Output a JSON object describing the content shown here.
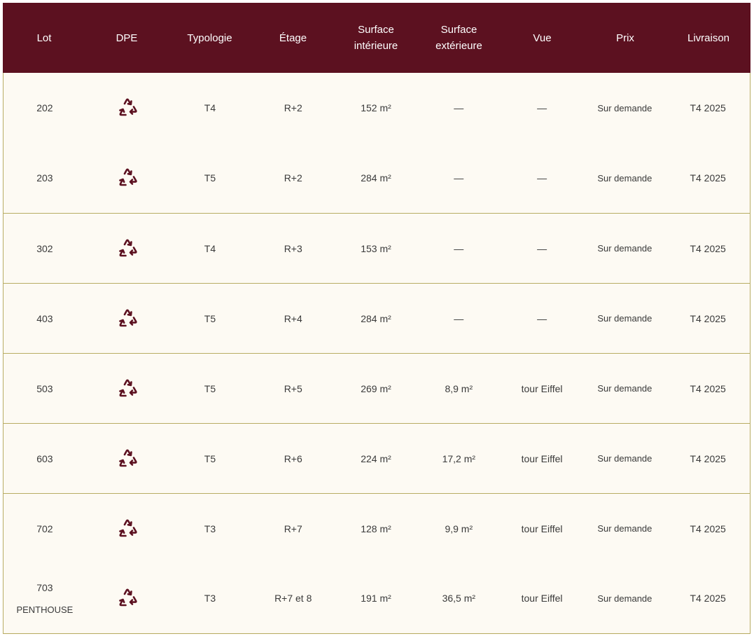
{
  "headers": {
    "lot": "Lot",
    "dpe": "DPE",
    "typologie": "Typologie",
    "etage": "Étage",
    "surface_interieure": "Surface\nintérieure",
    "surface_exterieure": "Surface\nextérieure",
    "vue": "Vue",
    "prix": "Prix",
    "livraison": "Livraison"
  },
  "accent_color": "#5c1120",
  "border_color": "#b8ac63",
  "dpe_icon": "recycle-icon",
  "rows": [
    {
      "lot": "202",
      "lot_sub": "",
      "typologie": "T4",
      "etage": "R+2",
      "surface_int": "152 m²",
      "surface_ext": "—",
      "vue": "—",
      "prix": "Sur demande",
      "livraison": "T4 2025"
    },
    {
      "lot": "203",
      "lot_sub": "",
      "typologie": "T5",
      "etage": "R+2",
      "surface_int": "284 m²",
      "surface_ext": "—",
      "vue": "—",
      "prix": "Sur demande",
      "livraison": "T4 2025"
    },
    {
      "lot": "302",
      "lot_sub": "",
      "typologie": "T4",
      "etage": "R+3",
      "surface_int": "153 m²",
      "surface_ext": "—",
      "vue": "—",
      "prix": "Sur demande",
      "livraison": "T4 2025"
    },
    {
      "lot": "403",
      "lot_sub": "",
      "typologie": "T5",
      "etage": "R+4",
      "surface_int": "284 m²",
      "surface_ext": "—",
      "vue": "—",
      "prix": "Sur demande",
      "livraison": "T4 2025"
    },
    {
      "lot": "503",
      "lot_sub": "",
      "typologie": "T5",
      "etage": "R+5",
      "surface_int": "269 m²",
      "surface_ext": "8,9 m²",
      "vue": "tour Eiffel",
      "prix": "Sur demande",
      "livraison": "T4 2025"
    },
    {
      "lot": "603",
      "lot_sub": "",
      "typologie": "T5",
      "etage": "R+6",
      "surface_int": "224 m²",
      "surface_ext": "17,2 m²",
      "vue": "tour Eiffel",
      "prix": "Sur demande",
      "livraison": "T4 2025"
    },
    {
      "lot": "702",
      "lot_sub": "",
      "typologie": "T3",
      "etage": "R+7",
      "surface_int": "128 m²",
      "surface_ext": "9,9 m²",
      "vue": "tour Eiffel",
      "prix": "Sur demande",
      "livraison": "T4 2025"
    },
    {
      "lot": "703",
      "lot_sub": "PENTHOUSE",
      "typologie": "T3",
      "etage": "R+7 et 8",
      "surface_int": "191 m²",
      "surface_ext": "36,5 m²",
      "vue": "tour Eiffel",
      "prix": "Sur demande",
      "livraison": "T4 2025"
    }
  ]
}
